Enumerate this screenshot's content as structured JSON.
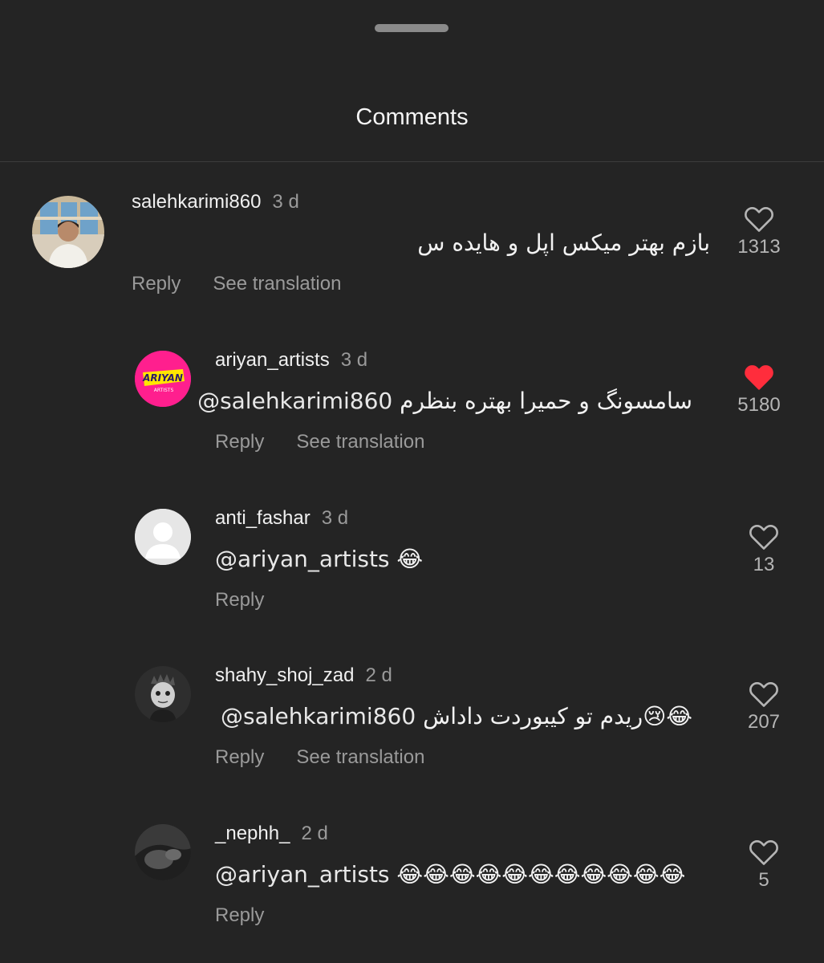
{
  "header": {
    "title": "Comments"
  },
  "colors": {
    "background": "#242424",
    "liked": "#ff2d3c",
    "muted": "#9a9a9a"
  },
  "comments": [
    {
      "username": "salehkarimi860",
      "time": "3 d",
      "text": "بازم بهتر میکس اپل و هایده س",
      "reply": "Reply",
      "translation": "See translation",
      "likes": "1313",
      "liked": false,
      "avatar_icon": "user-photo-avatar"
    },
    {
      "username": "ariyan_artists",
      "time": "3 d",
      "mention": "@salehkarimi860",
      "text": "سامسونگ و حمیرا بهتره بنظرم",
      "reply": "Reply",
      "translation": "See translation",
      "likes": "5180",
      "liked": true,
      "avatar_icon": "ariyan-artists-logo",
      "avatar_logo_text": "ARIYAN ARTISTS"
    },
    {
      "username": "anti_fashar",
      "time": "3 d",
      "mention": "@ariyan_artists",
      "text": "😂",
      "reply": "Reply",
      "likes": "13",
      "liked": false,
      "avatar_icon": "default-avatar"
    },
    {
      "username": "shahy_shoj_zad",
      "time": "2 d",
      "mention": "@salehkarimi860",
      "text": "😂😢ریدم تو کیبوردت داداش",
      "reply": "Reply",
      "translation": "See translation",
      "likes": "207",
      "liked": false,
      "avatar_icon": "cartoon-avatar"
    },
    {
      "username": "_nephh_",
      "time": "2 d",
      "mention": "@ariyan_artists",
      "text": "😂😂😂😂😂😂😂😂😂😂😂",
      "reply": "Reply",
      "likes": "5",
      "liked": false,
      "avatar_icon": "dark-photo-avatar"
    }
  ]
}
